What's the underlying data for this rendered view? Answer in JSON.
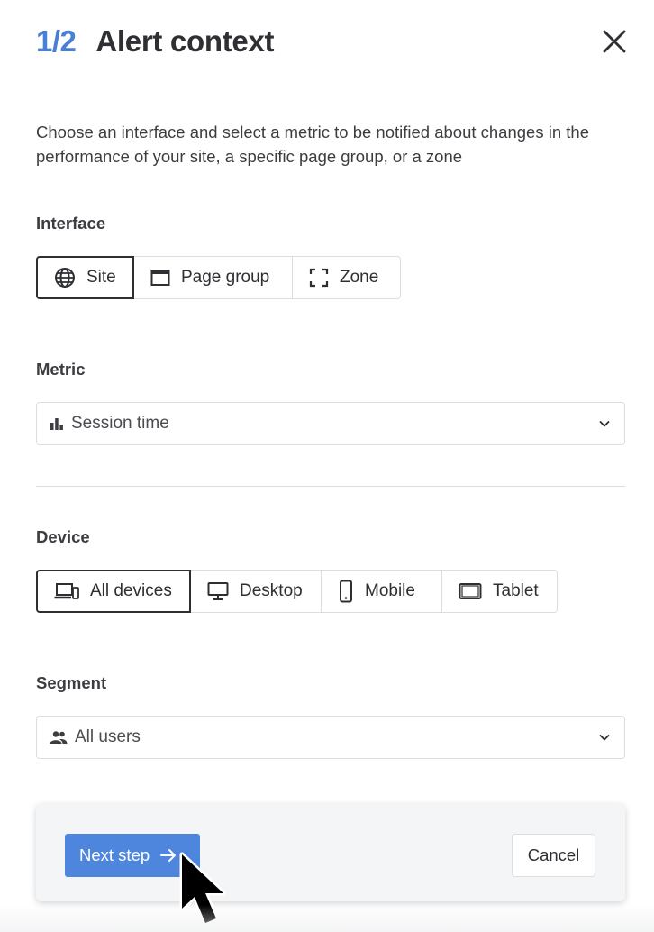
{
  "header": {
    "step": "1/2",
    "title": "Alert context",
    "close_icon": "close-icon"
  },
  "description": "Choose an interface and select a metric to be notified about changes in the performance of your site, a specific page group, or a zone",
  "interface": {
    "label": "Interface",
    "selected": "Site",
    "options": [
      {
        "label": "Site",
        "icon": "globe-icon"
      },
      {
        "label": "Page group",
        "icon": "browser-window-icon"
      },
      {
        "label": "Zone",
        "icon": "zone-frame-icon"
      }
    ]
  },
  "metric": {
    "label": "Metric",
    "value": "Session time",
    "icon": "bar-chart-icon"
  },
  "device": {
    "label": "Device",
    "selected": "All devices",
    "options": [
      {
        "label": "All devices",
        "icon": "devices-icon"
      },
      {
        "label": "Desktop",
        "icon": "desktop-icon"
      },
      {
        "label": "Mobile",
        "icon": "mobile-icon"
      },
      {
        "label": "Tablet",
        "icon": "tablet-icon"
      }
    ]
  },
  "segment": {
    "label": "Segment",
    "value": "All users",
    "icon": "users-icon"
  },
  "footer": {
    "next_label": "Next step",
    "cancel_label": "Cancel"
  },
  "colors": {
    "accent": "#4f86dd",
    "step": "#4a7fd6",
    "text": "#2d2f33",
    "border": "#dcdde0",
    "footer_bg": "#f4f5f7"
  }
}
